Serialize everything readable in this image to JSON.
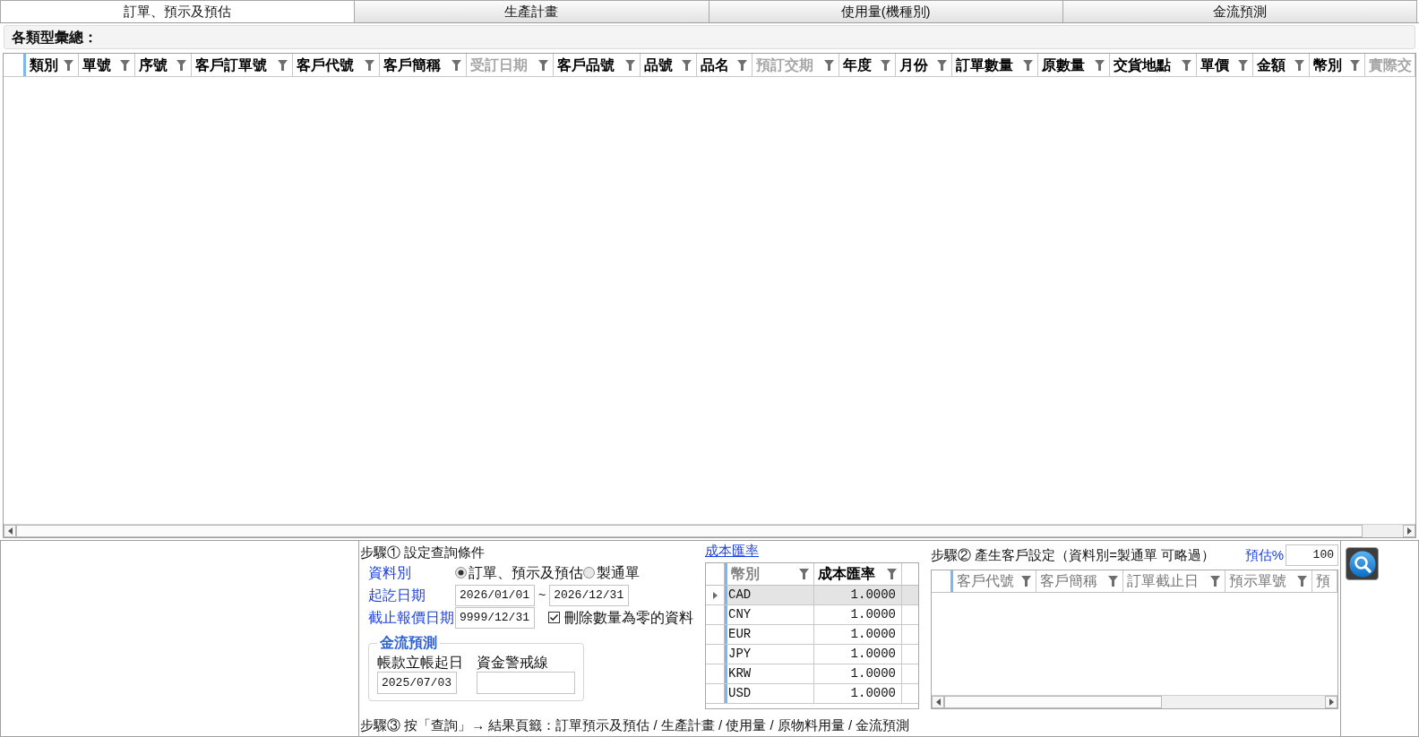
{
  "tabs": [
    {
      "label": "訂單、預示及預估",
      "selected": true
    },
    {
      "label": "生產計畫",
      "selected": false
    },
    {
      "label": "使用量(機種別)",
      "selected": false
    },
    {
      "label": "金流預測",
      "selected": false
    }
  ],
  "summary": {
    "label": "各類型彙總："
  },
  "main_grid": {
    "columns": [
      {
        "label": "類別",
        "disabled": false
      },
      {
        "label": "單號",
        "disabled": false
      },
      {
        "label": "序號",
        "disabled": false
      },
      {
        "label": "客戶訂單號",
        "disabled": false
      },
      {
        "label": "客戶代號",
        "disabled": false
      },
      {
        "label": "客戶簡稱",
        "disabled": false
      },
      {
        "label": "受訂日期",
        "disabled": true
      },
      {
        "label": "客戶品號",
        "disabled": false
      },
      {
        "label": "品號",
        "disabled": false
      },
      {
        "label": "品名",
        "disabled": false
      },
      {
        "label": "預訂交期",
        "disabled": true
      },
      {
        "label": "年度",
        "disabled": false
      },
      {
        "label": "月份",
        "disabled": false
      },
      {
        "label": "訂單數量",
        "disabled": false
      },
      {
        "label": "原數量",
        "disabled": false
      },
      {
        "label": "交貨地點",
        "disabled": false
      },
      {
        "label": "單價",
        "disabled": false
      },
      {
        "label": "金額",
        "disabled": false
      },
      {
        "label": "幣別",
        "disabled": false
      },
      {
        "label": "實際交",
        "disabled": true
      }
    ]
  },
  "query": {
    "title": "步驟① 設定查詢條件",
    "data_type": {
      "label": "資料別",
      "options": [
        {
          "label": "訂單、預示及預估",
          "selected": true
        },
        {
          "label": "製通單",
          "selected": false
        }
      ]
    },
    "date_range": {
      "label": "起訖日期",
      "from": "2026/01/01",
      "separator": "~",
      "to": "2026/12/31"
    },
    "quote_cutoff": {
      "label": "截止報價日期",
      "value": "9999/12/31"
    },
    "delete_zero": {
      "label": "刪除數量為零的資料",
      "checked": true
    },
    "cashflow": {
      "title": "金流預測",
      "fields": [
        {
          "label": "帳款立帳起日",
          "value": "2025/07/03"
        },
        {
          "label": "資金警戒線"
        }
      ]
    }
  },
  "exchange_rates": {
    "title": "成本匯率",
    "columns": [
      {
        "label": "幣別",
        "disabled": true
      },
      {
        "label": "成本匯率",
        "disabled": false
      }
    ],
    "rows": [
      {
        "currency": "CAD",
        "rate": "1.0000",
        "selected": true
      },
      {
        "currency": "CNY",
        "rate": "1.0000",
        "selected": false
      },
      {
        "currency": "EUR",
        "rate": "1.0000",
        "selected": false
      },
      {
        "currency": "JPY",
        "rate": "1.0000",
        "selected": false
      },
      {
        "currency": "KRW",
        "rate": "1.0000",
        "selected": false
      },
      {
        "currency": "USD",
        "rate": "1.0000",
        "selected": false
      }
    ]
  },
  "customer_setup": {
    "title": "步驟② 產生客戶設定（資料別=製通單 可略過）",
    "estimate": {
      "label": "預估%",
      "value": "100"
    },
    "columns": [
      {
        "label": "客戶代號",
        "disabled": true
      },
      {
        "label": "客戶簡稱",
        "disabled": true
      },
      {
        "label": "訂單截止日",
        "disabled": true
      },
      {
        "label": "預示單號",
        "disabled": true
      },
      {
        "label": "預",
        "disabled": true
      }
    ]
  },
  "step3": {
    "text": "步驟③ 按「查詢」→ 結果頁籤：訂單預示及預估 / 生產計畫 / 使用量 / 原物料用量 / 金流預測"
  }
}
